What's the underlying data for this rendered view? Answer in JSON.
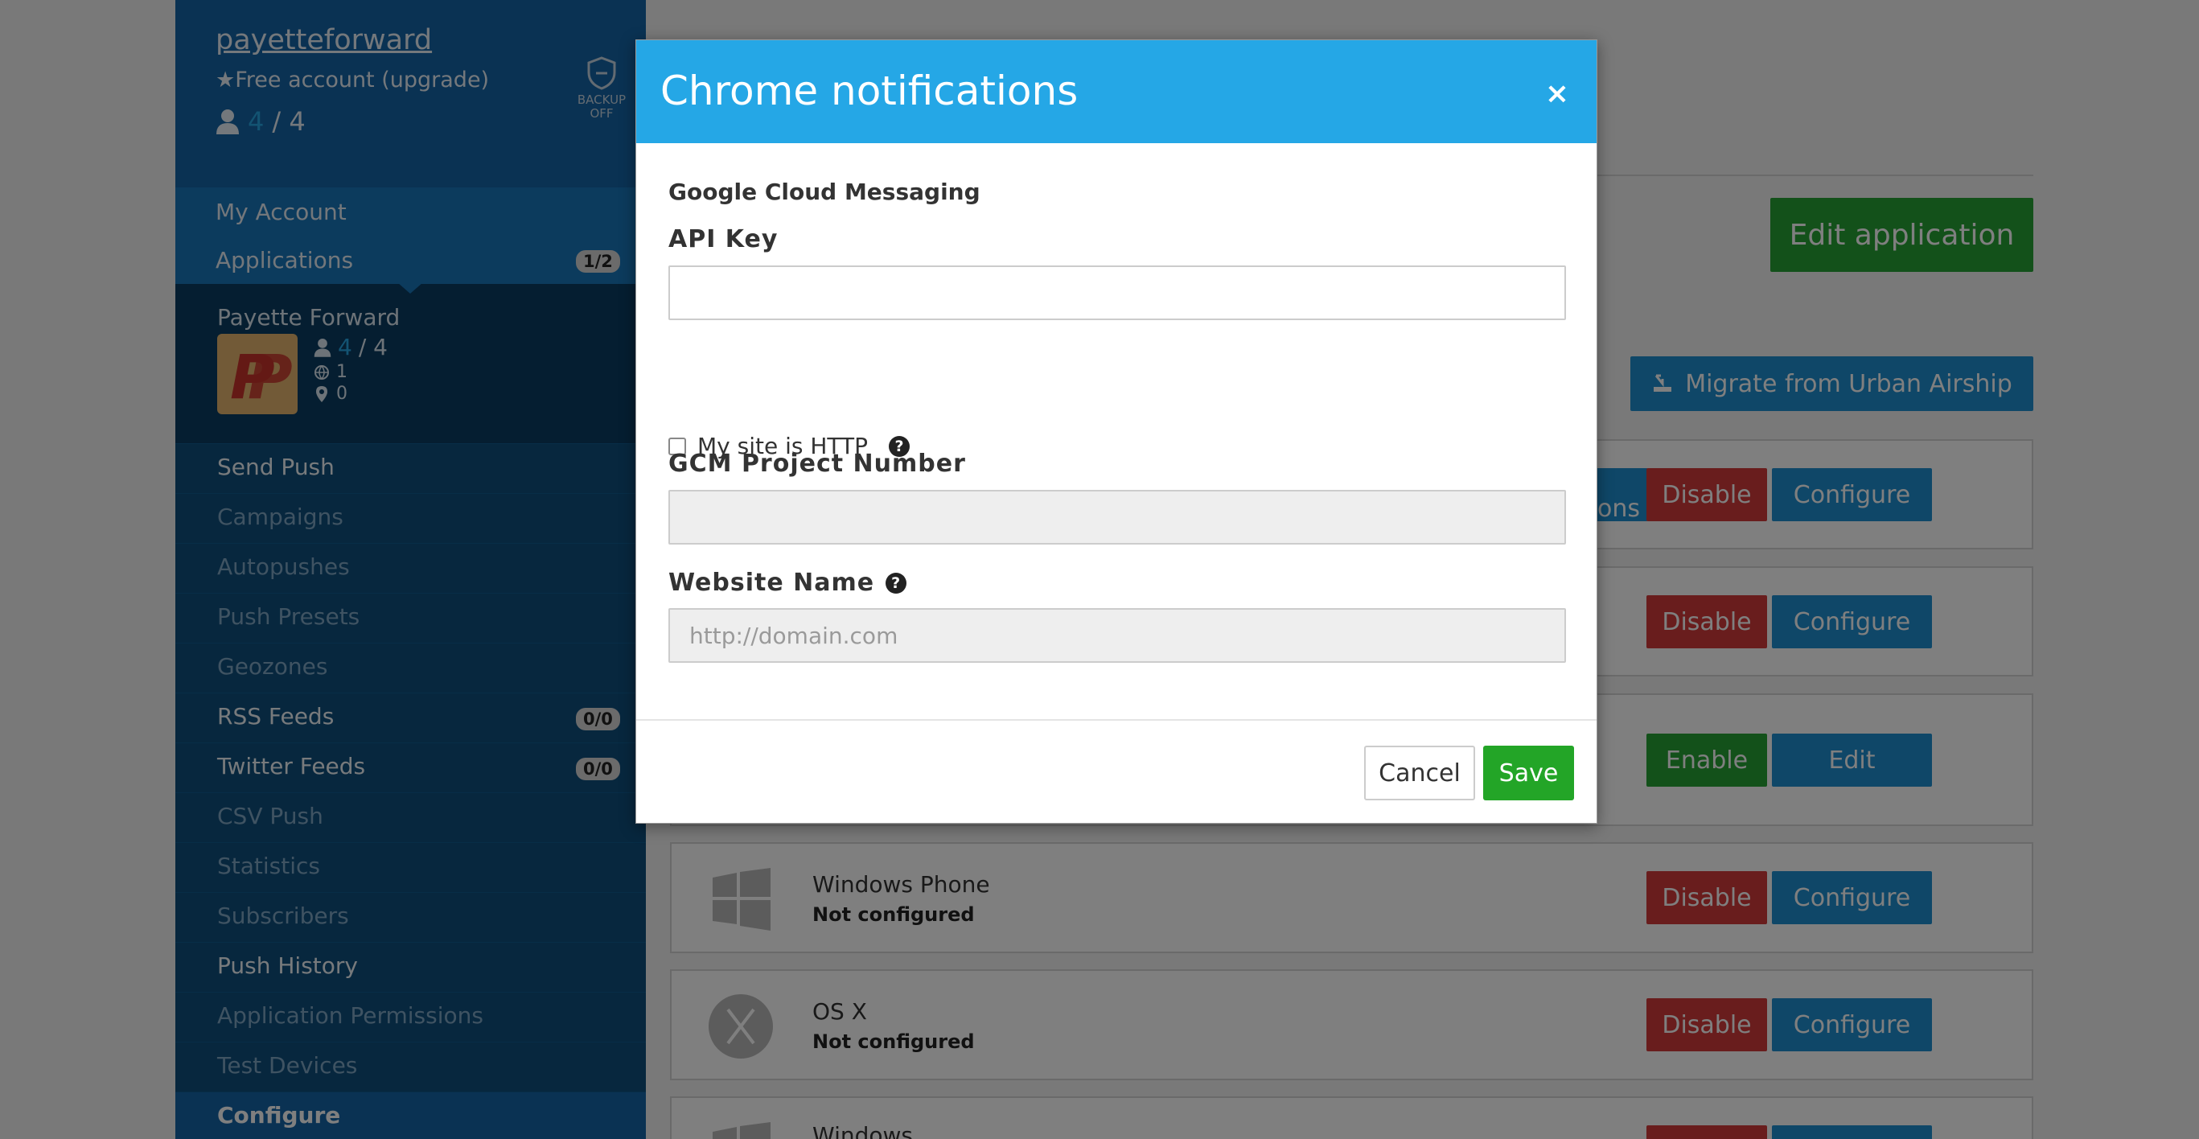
{
  "sidebar": {
    "account": {
      "username": "payetteforward",
      "plan": "★Free account (upgrade)",
      "users_current": "4",
      "users_separator": "/ 4",
      "backup_line1": "BACKUP",
      "backup_line2": "OFF"
    },
    "account_nav": [
      {
        "label": "My Account"
      },
      {
        "label": "Applications",
        "badge": "1/2"
      }
    ],
    "app": {
      "title": "Payette Forward",
      "users_current": "4",
      "users_separator": "/ 4",
      "web_count": "1",
      "location_count": "0"
    },
    "items": [
      {
        "label": "Send Push"
      },
      {
        "label": "Campaigns"
      },
      {
        "label": "Autopushes"
      },
      {
        "label": "Push Presets"
      },
      {
        "label": "Geozones"
      },
      {
        "label": "RSS Feeds",
        "badge": "0/0"
      },
      {
        "label": "Twitter Feeds",
        "badge": "0/0"
      },
      {
        "label": "CSV Push"
      },
      {
        "label": "Statistics"
      },
      {
        "label": "Subscribers"
      },
      {
        "label": "Push History"
      },
      {
        "label": "Application Permissions"
      },
      {
        "label": "Test Devices"
      },
      {
        "label": "Configure"
      }
    ]
  },
  "main": {
    "edit_app_label": "Edit application",
    "migrate_label": "Migrate from Urban Airship",
    "row1": {
      "actions_label": "t Actions",
      "disable_label": "Disable",
      "configure_label": "Configure"
    },
    "row2": {
      "disable_label": "Disable",
      "configure_label": "Configure"
    },
    "row3": {
      "enable_label": "Enable",
      "edit_label": "Edit"
    },
    "platforms": [
      {
        "name": "Windows Phone",
        "status": "Not configured",
        "disable_label": "Disable",
        "configure_label": "Configure"
      },
      {
        "name": "OS X",
        "status": "Not configured",
        "disable_label": "Disable",
        "configure_label": "Configure"
      },
      {
        "name": "Windows"
      }
    ],
    "colors": {
      "green": "#27a235",
      "blue": "#1e8fd0",
      "red": "#d23a3a"
    }
  },
  "modal": {
    "title": "Chrome notifications",
    "close": "×",
    "section_title": "Google Cloud Messaging",
    "api_key_label": "API Key",
    "api_key_value": "",
    "http_checkbox_label": "My site is HTTP",
    "http_checked": false,
    "gcm_label": "GCM Project Number",
    "gcm_value": "",
    "website_label": "Website Name",
    "website_placeholder": "http://domain.com",
    "cancel_label": "Cancel",
    "save_label": "Save",
    "header_color": "#25a7e6"
  }
}
